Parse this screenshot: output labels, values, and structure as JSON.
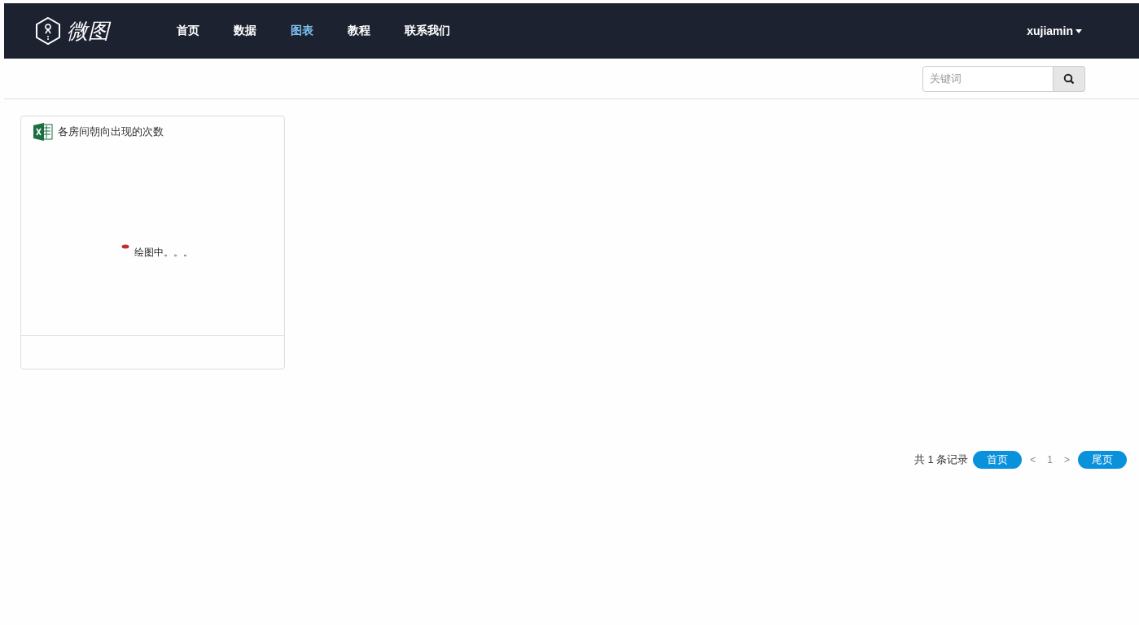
{
  "navbar": {
    "logo_text": "微图",
    "items": [
      {
        "label": "首页",
        "selected": false
      },
      {
        "label": "数据",
        "selected": false
      },
      {
        "label": "图表",
        "selected": true
      },
      {
        "label": "教程",
        "selected": false
      },
      {
        "label": "联系我们",
        "selected": false
      }
    ],
    "user": "xujiamin"
  },
  "search": {
    "placeholder": "关键词"
  },
  "cards": [
    {
      "title": "各房间朝向出现的次数",
      "status": "绘图中。。。"
    }
  ],
  "pagination": {
    "summary": "共 1 条记录",
    "buttons": [
      {
        "label": "首页",
        "kind": "button",
        "disabled": false
      },
      {
        "label": "<",
        "kind": "link",
        "disabled": true
      },
      {
        "label": "1",
        "kind": "link",
        "disabled": true
      },
      {
        "label": ">",
        "kind": "link",
        "disabled": true
      },
      {
        "label": "尾页",
        "kind": "button",
        "disabled": false
      }
    ]
  }
}
